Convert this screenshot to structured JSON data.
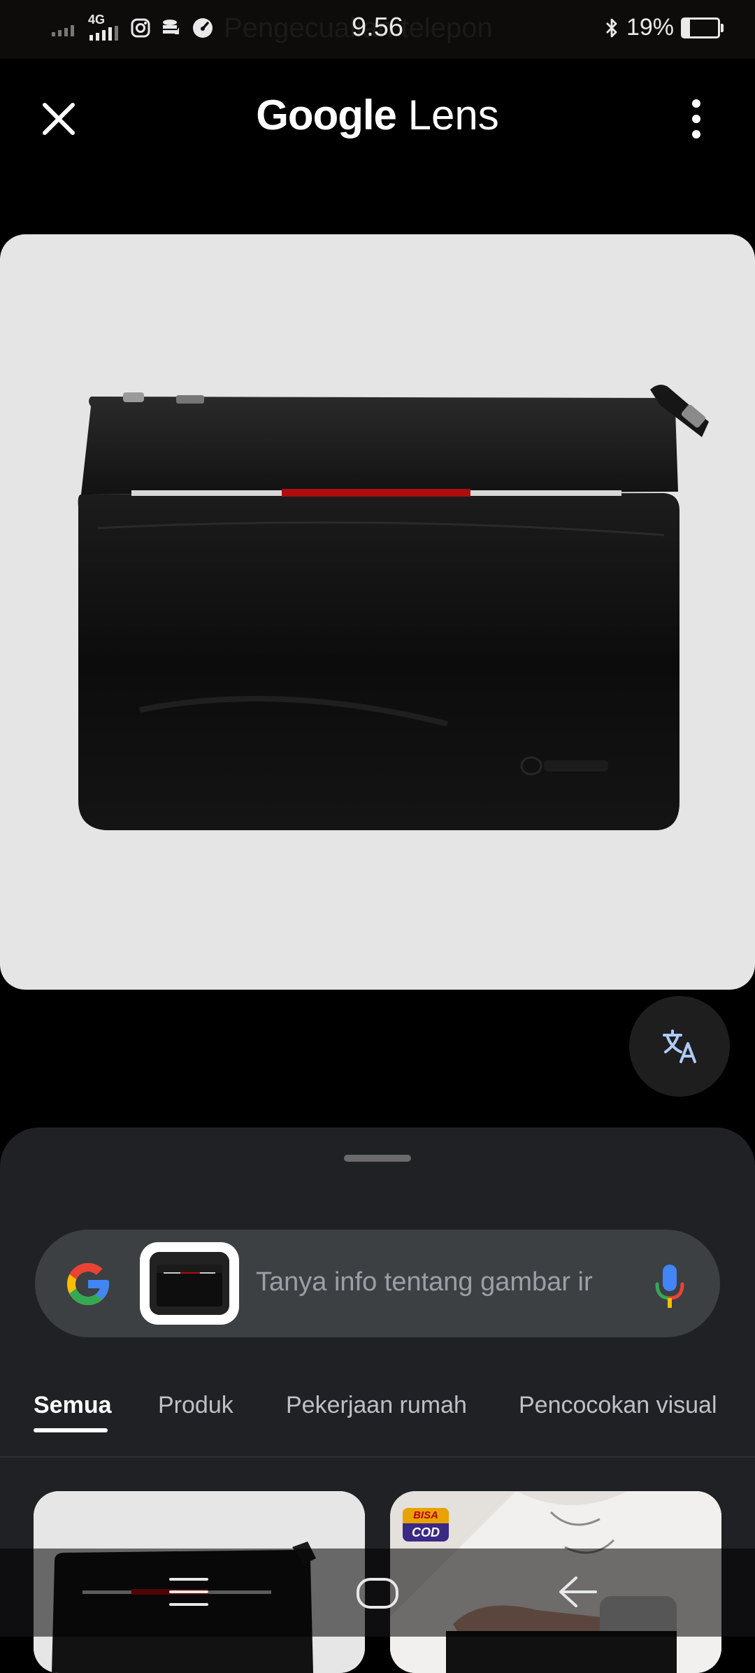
{
  "status_bar": {
    "time": "9.56",
    "ghost_text": "Pengecualian telepon",
    "network": "4G",
    "battery": "19%",
    "battery_level": 0.19
  },
  "header": {
    "title_google": "Google",
    "title_lens": "Lens"
  },
  "image": {
    "subject": "black leather clutch bag"
  },
  "search": {
    "placeholder": "Tanya info tentang gambar ir"
  },
  "tabs": [
    {
      "label": "Semua",
      "active": true
    },
    {
      "label": "Produk",
      "active": false
    },
    {
      "label": "Pekerjaan rumah",
      "active": false
    },
    {
      "label": "Pencocokan visual",
      "active": false
    }
  ],
  "results": [
    {
      "badge": null
    },
    {
      "badge_top": "BISA",
      "badge_bottom": "COD"
    }
  ],
  "icons": {
    "close": "close-icon",
    "more": "more-vert-icon",
    "translate": "translate-icon",
    "google": "google-g-icon",
    "mic": "mic-icon",
    "nav_menu": "menu-icon",
    "nav_home": "home-icon",
    "nav_back": "back-icon"
  },
  "colors": {
    "accent_google_blue": "#4285F4",
    "google_red": "#EA4335",
    "google_yellow": "#FBBC05",
    "google_green": "#34A853",
    "sheet_bg": "#202124",
    "searchbar_bg": "#3c4043"
  }
}
